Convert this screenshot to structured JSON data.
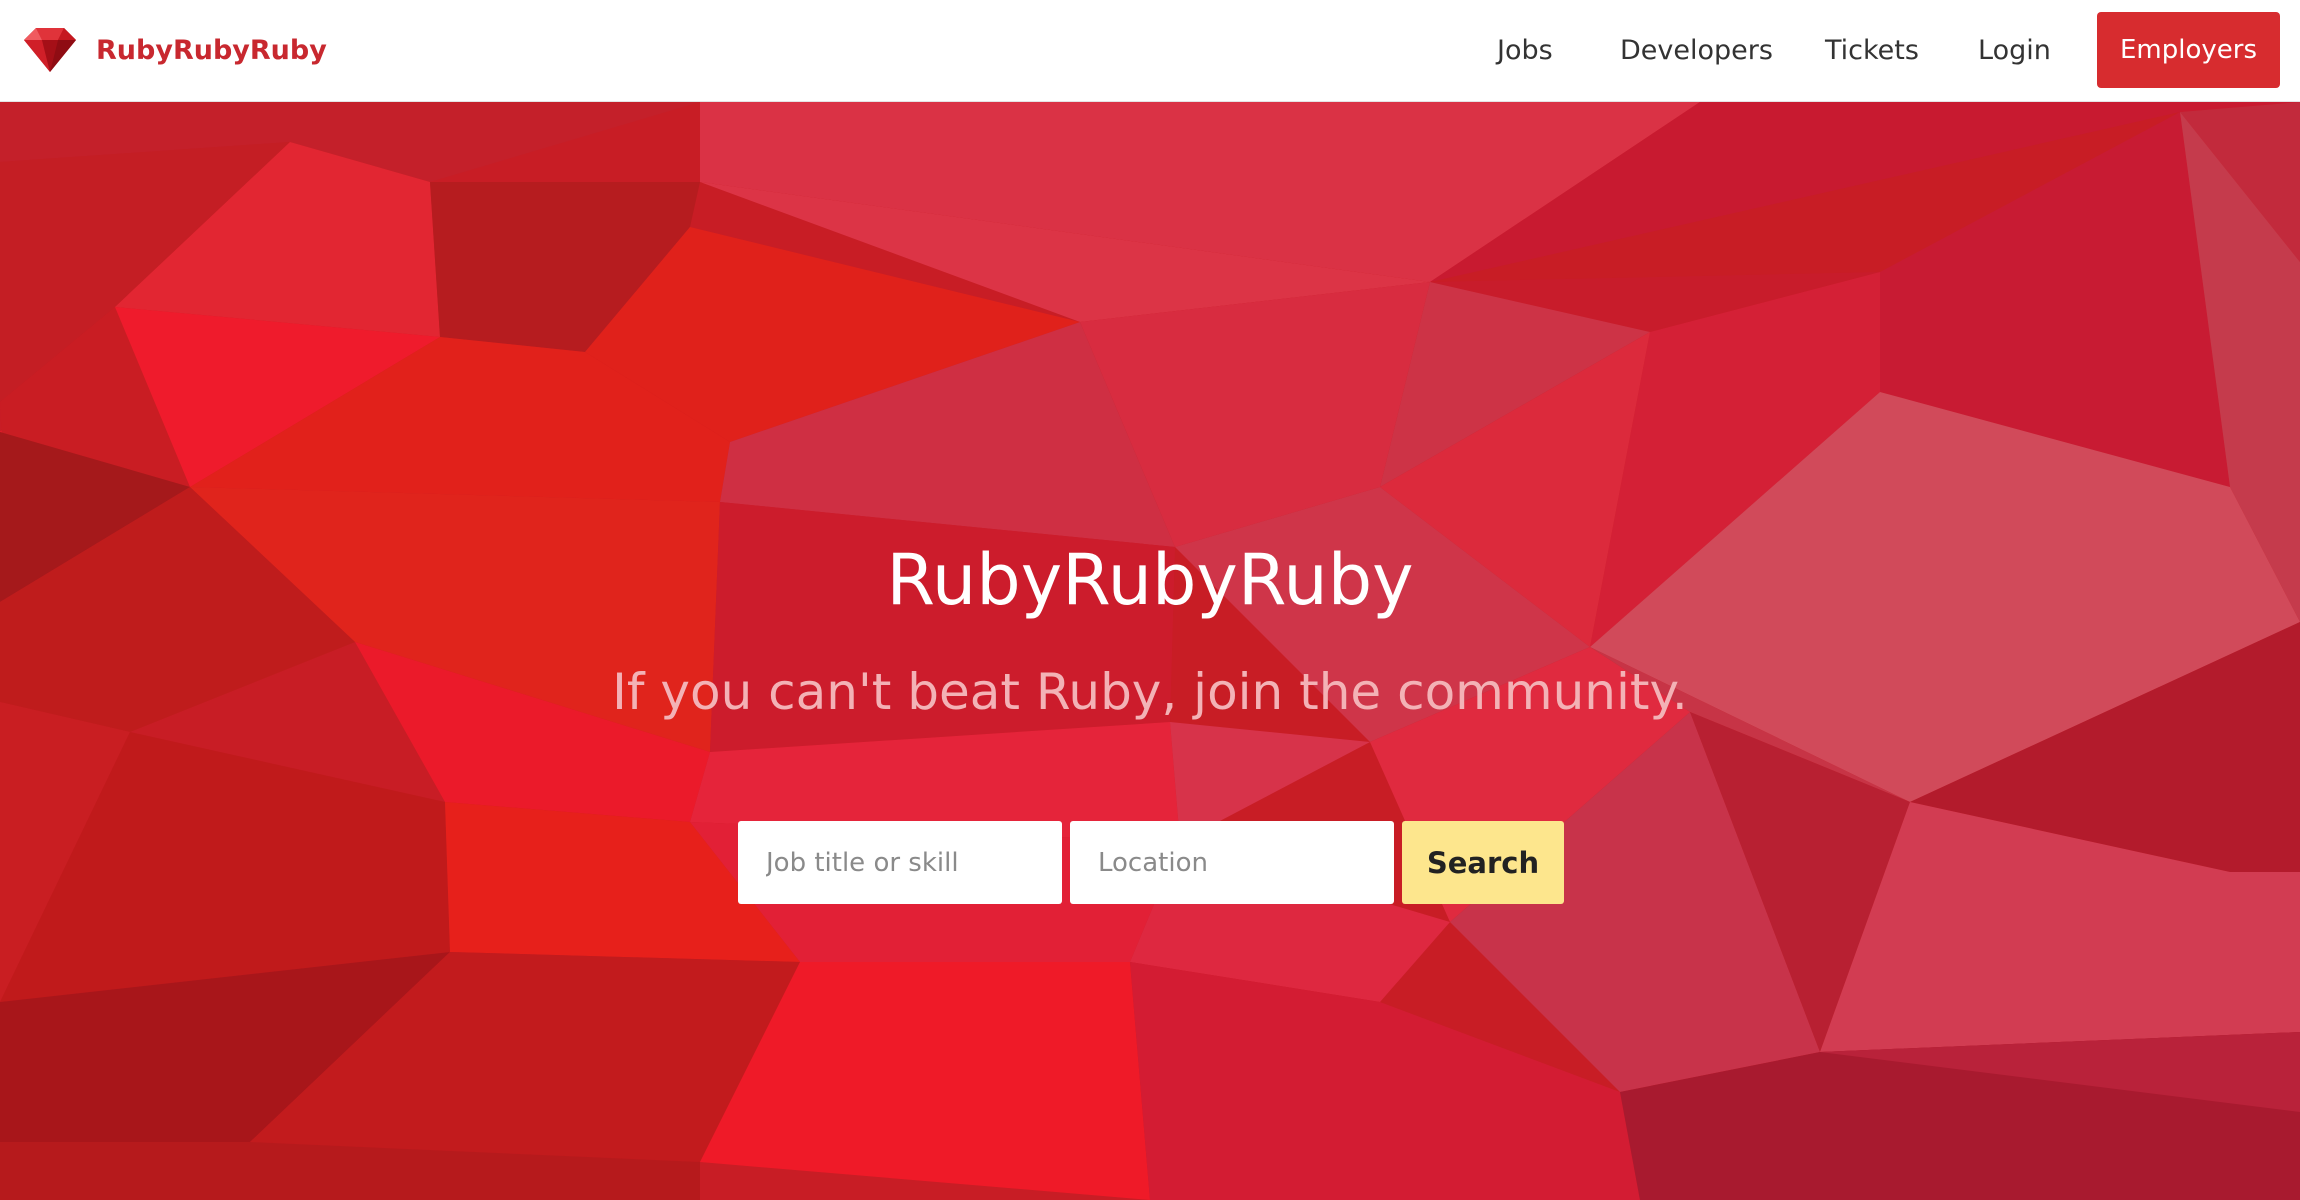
{
  "brand": {
    "name": "RubyRubyRuby",
    "icon": "ruby-gem-icon"
  },
  "nav": {
    "jobs": "Jobs",
    "developers": "Developers",
    "tickets": "Tickets",
    "login": "Login",
    "employers": "Employers"
  },
  "hero": {
    "title": "RubyRubyRuby",
    "tagline": "If you can't beat Ruby, join the community."
  },
  "search": {
    "job_placeholder": "Job title or skill",
    "location_placeholder": "Location",
    "button": "Search"
  },
  "colors": {
    "brand_red": "#c8282f",
    "employers_button": "#d72c2f",
    "search_button": "#fde68d",
    "hero_base": "#c81d25"
  }
}
